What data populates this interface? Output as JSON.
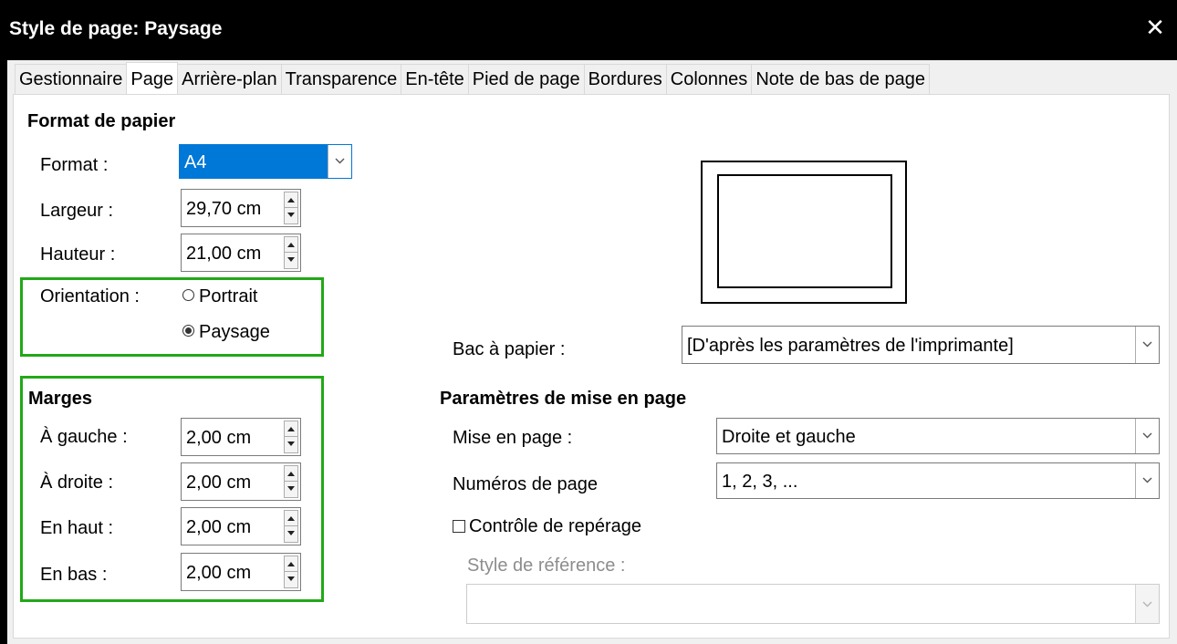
{
  "window": {
    "title": "Style de page: Paysage",
    "close_glyph": "✕"
  },
  "tabs": [
    {
      "label": "Gestionnaire",
      "active": false
    },
    {
      "label": "Page",
      "active": true
    },
    {
      "label": "Arrière-plan",
      "active": false
    },
    {
      "label": "Transparence",
      "active": false
    },
    {
      "label": "En-tête",
      "active": false
    },
    {
      "label": "Pied de page",
      "active": false
    },
    {
      "label": "Bordures",
      "active": false
    },
    {
      "label": "Colonnes",
      "active": false
    },
    {
      "label": "Note de bas de page",
      "active": false
    }
  ],
  "paper_format": {
    "title": "Format de papier",
    "format_label": "Format :",
    "format_value": "A4",
    "width_label": "Largeur :",
    "width_value": "29,70 cm",
    "height_label": "Hauteur :",
    "height_value": "21,00 cm",
    "orientation_label": "Orientation :",
    "portrait_label": "Portrait",
    "landscape_label": "Paysage",
    "orientation_selected": "Paysage"
  },
  "margins": {
    "title": "Marges",
    "left_label": "À gauche :",
    "left_value": "2,00 cm",
    "right_label": "À droite :",
    "right_value": "2,00 cm",
    "top_label": "En haut :",
    "top_value": "2,00 cm",
    "bottom_label": "En bas :",
    "bottom_value": "2,00 cm"
  },
  "paper_tray": {
    "label": "Bac à papier :",
    "value": "[D'après les paramètres de l'imprimante]"
  },
  "layout_settings": {
    "title": "Paramètres de mise en page",
    "layout_label": "Mise en page :",
    "layout_value": "Droite et gauche",
    "page_numbers_label": "Numéros de page",
    "page_numbers_value": "1, 2, 3, ...",
    "register_true_label": "Contrôle de repérage",
    "register_true_checked": false,
    "reference_style_label": "Style de référence :",
    "reference_style_value": ""
  },
  "colors": {
    "highlight_box": "#22a818",
    "selection": "#0078d7",
    "titlebar": "#000000"
  }
}
